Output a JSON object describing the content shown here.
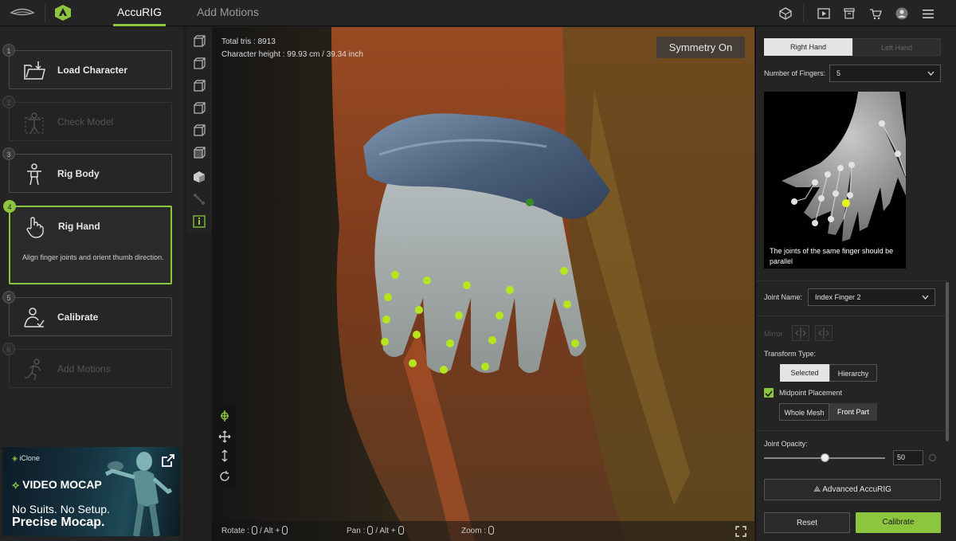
{
  "topbar": {
    "tabs": [
      {
        "label": "AccuRIG",
        "active": true
      },
      {
        "label": "Add Motions",
        "active": false
      }
    ],
    "icons": [
      "reallusion-logo-icon",
      "accurig-logo-icon",
      "cube-icon",
      "play-icon",
      "archive-icon",
      "cart-icon",
      "user-avatar-icon",
      "menu-icon"
    ]
  },
  "steps": [
    {
      "num": "1",
      "label": "Load Character",
      "state": "normal",
      "icon": "load-folder-icon"
    },
    {
      "num": "2",
      "label": "Check Model",
      "state": "disabled",
      "icon": "check-model-icon"
    },
    {
      "num": "3",
      "label": "Rig Body",
      "state": "normal",
      "icon": "body-icon"
    },
    {
      "num": "4",
      "label": "Rig Hand",
      "state": "active",
      "icon": "hand-pointer-icon",
      "desc": "Align finger joints and orient thumb direction."
    },
    {
      "num": "5",
      "label": "Calibrate",
      "state": "normal",
      "icon": "calibrate-icon"
    },
    {
      "num": "6",
      "label": "Add Motions",
      "state": "disabled",
      "icon": "run-icon"
    }
  ],
  "ad": {
    "brand": "iClone",
    "headline": "VIDEO MOCAP",
    "line1": "No Suits. No Setup.",
    "line2": "Precise Mocap."
  },
  "viewport": {
    "total_tris": "Total tris : 8913",
    "char_height": "Character height : 99.93 cm / 39.34 inch",
    "symmetry": "Symmetry On",
    "hints": {
      "rotate": "Rotate :",
      "alt1": "/  Alt  +",
      "pan": "Pan :",
      "alt2": "/  Alt  +",
      "zoom": "Zoom :"
    }
  },
  "right": {
    "hand_tabs": [
      {
        "label": "Right Hand",
        "active": true
      },
      {
        "label": "Left Hand",
        "active": false
      }
    ],
    "fingers_label": "Number of Fingers:",
    "fingers_value": "5",
    "preview_caption": "The joints of the same finger should be parallel",
    "joint_name_label": "Joint Name:",
    "joint_name_value": "Index Finger 2",
    "mirror_label": "Mirror",
    "transform_label": "Transform Type:",
    "transform_options": [
      {
        "label": "Selected",
        "active": true
      },
      {
        "label": "Hierarchy",
        "active": false
      }
    ],
    "midpoint_label": "Midpoint Placement",
    "midpoint_checked": true,
    "mesh_options": [
      {
        "label": "Whole Mesh",
        "active": false
      },
      {
        "label": "Front Part",
        "active": true
      }
    ],
    "opacity_label": "Joint Opacity:",
    "opacity_value": "50",
    "opacity_fraction": 0.5,
    "advanced_label": "Advanced AccuRIG",
    "reset_label": "Reset",
    "calibrate_label": "Calibrate"
  },
  "colors": {
    "accent": "#8cc63f",
    "panel": "#242424",
    "joint": "#b5e61d"
  }
}
